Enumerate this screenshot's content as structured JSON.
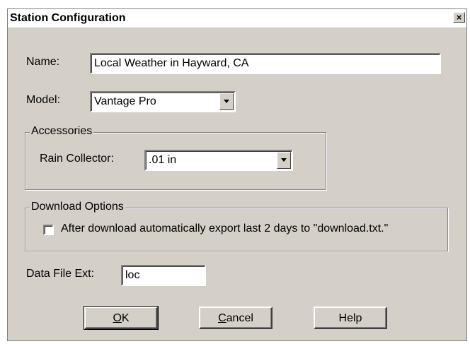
{
  "dialog": {
    "title": "Station Configuration",
    "close_glyph": "×"
  },
  "name": {
    "label": "Name:",
    "value": "Local Weather in Hayward, CA"
  },
  "model": {
    "label": "Model:",
    "value": "Vantage Pro"
  },
  "accessories": {
    "legend": "Accessories",
    "rain_label": "Rain Collector:",
    "rain_value": ".01 in"
  },
  "download_options": {
    "legend": "Download Options",
    "checkbox_label": "After download automatically export last 2 days to \"download.txt.\"",
    "checked": false
  },
  "data_file_ext": {
    "label": "Data File Ext:",
    "value": "loc"
  },
  "buttons": {
    "ok_mnemonic": "O",
    "ok_rest": "K",
    "cancel_mnemonic": "C",
    "cancel_rest": "ancel",
    "help": "Help"
  }
}
